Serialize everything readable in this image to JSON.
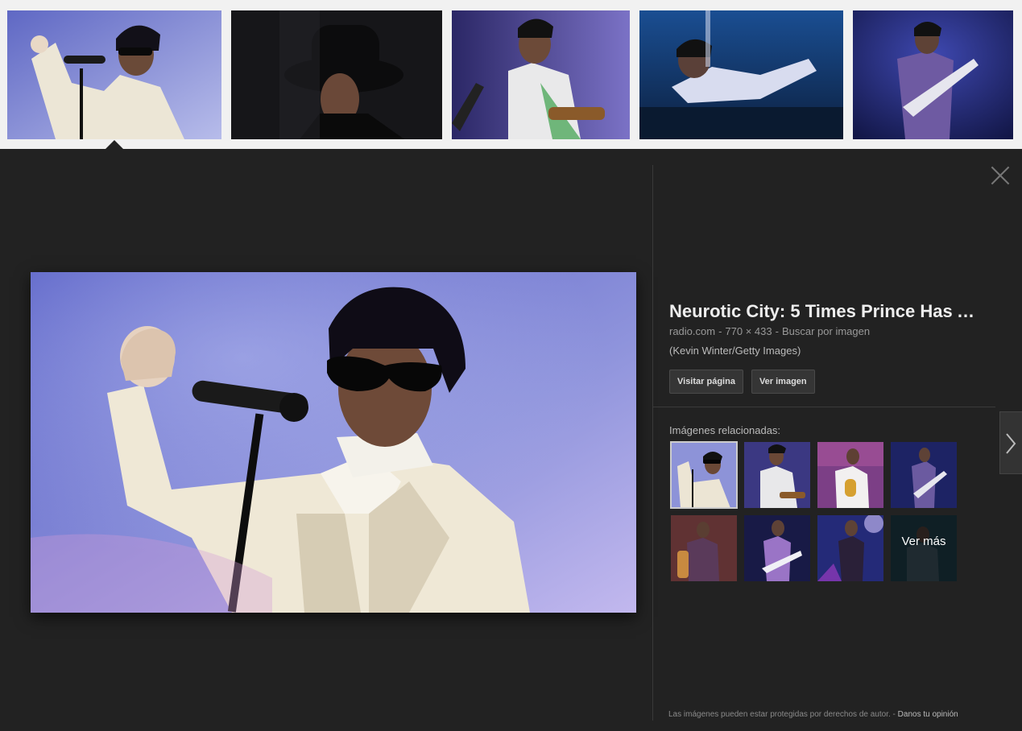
{
  "strip": {
    "thumbs": [
      {
        "name": "strip-thumb-1",
        "palette": [
          "#6a72c8",
          "#b4b9e8"
        ]
      },
      {
        "name": "strip-thumb-2",
        "palette": [
          "#141418",
          "#2a2a33"
        ]
      },
      {
        "name": "strip-thumb-3",
        "palette": [
          "#2e2a6a",
          "#7a74c2"
        ]
      },
      {
        "name": "strip-thumb-4",
        "palette": [
          "#0e2a56",
          "#2c5aa0"
        ]
      },
      {
        "name": "strip-thumb-5",
        "palette": [
          "#1a1f5e",
          "#3c46a8"
        ]
      }
    ]
  },
  "preview": {
    "title": "Neurotic City: 5 Times Prince Has Ac…",
    "source": "radio.com",
    "dimensions": "770 × 433",
    "search_by_image": "Buscar por imagen",
    "credit": "(Kevin Winter/Getty Images)",
    "visit_page_label": "Visitar página",
    "view_image_label": "Ver imagen",
    "related_label": "Imágenes relacionadas:",
    "see_more_label": "Ver más"
  },
  "footer": {
    "copyright_text": "Las imágenes pueden estar protegidas por derechos de autor.",
    "separator": "-",
    "feedback_label": "Danos tu opinión"
  },
  "colors": {
    "panel_background": "#222222",
    "strip_background": "#f1f1f1",
    "title_text": "#eeeeee"
  }
}
